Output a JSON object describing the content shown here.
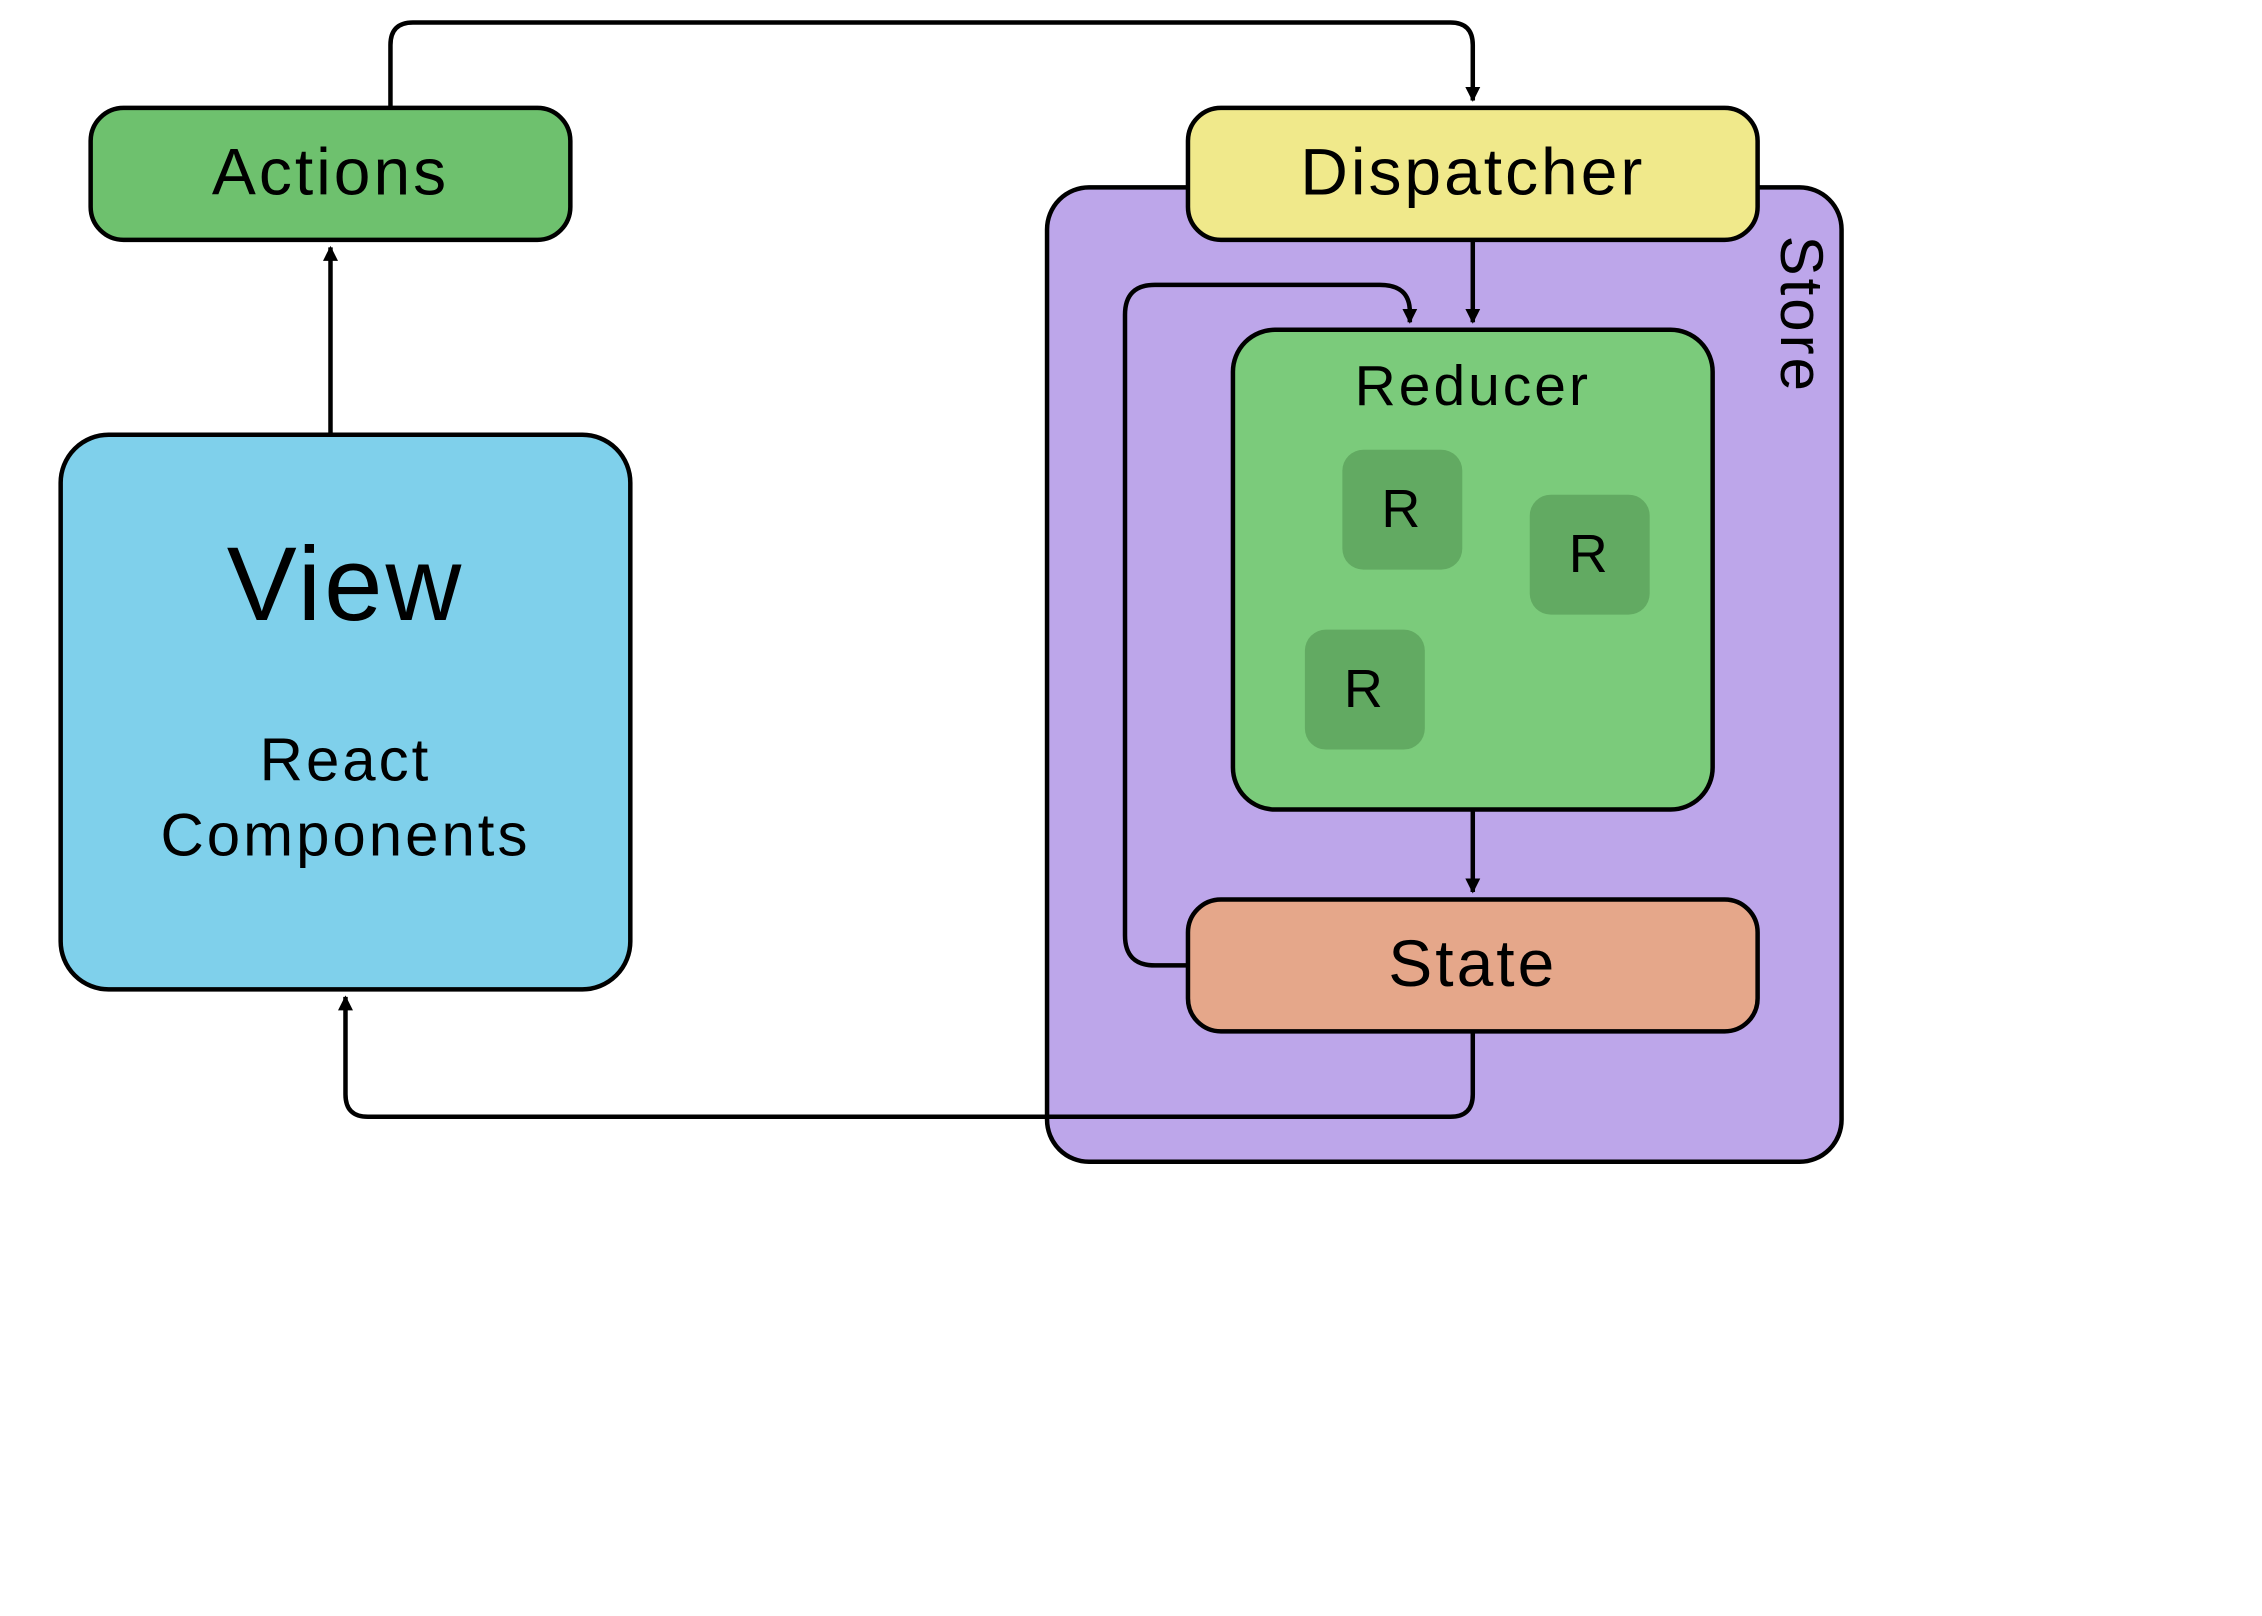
{
  "nodes": {
    "actions": {
      "label": "Actions",
      "fill": "#6ec16e"
    },
    "view": {
      "title": "View",
      "sub1": "React",
      "sub2": "Components",
      "fill": "#7fd0eb"
    },
    "dispatcher": {
      "label": "Dispatcher",
      "fill": "#f0e98b"
    },
    "store": {
      "label": "Store",
      "fill": "#bda6ea"
    },
    "reducer": {
      "label": "Reducer",
      "fill": "#7bcb7b"
    },
    "reducer_small": {
      "label": "R",
      "fill": "#62aa62"
    },
    "state": {
      "label": "State",
      "fill": "#e5a78a"
    }
  },
  "colors": {
    "stroke": "#000000",
    "background": "#ffffff"
  },
  "flow": [
    "View → Actions",
    "Actions → Dispatcher",
    "Dispatcher → Reducer",
    "State → Reducer (self-feedback)",
    "Reducer → State",
    "State → View"
  ]
}
